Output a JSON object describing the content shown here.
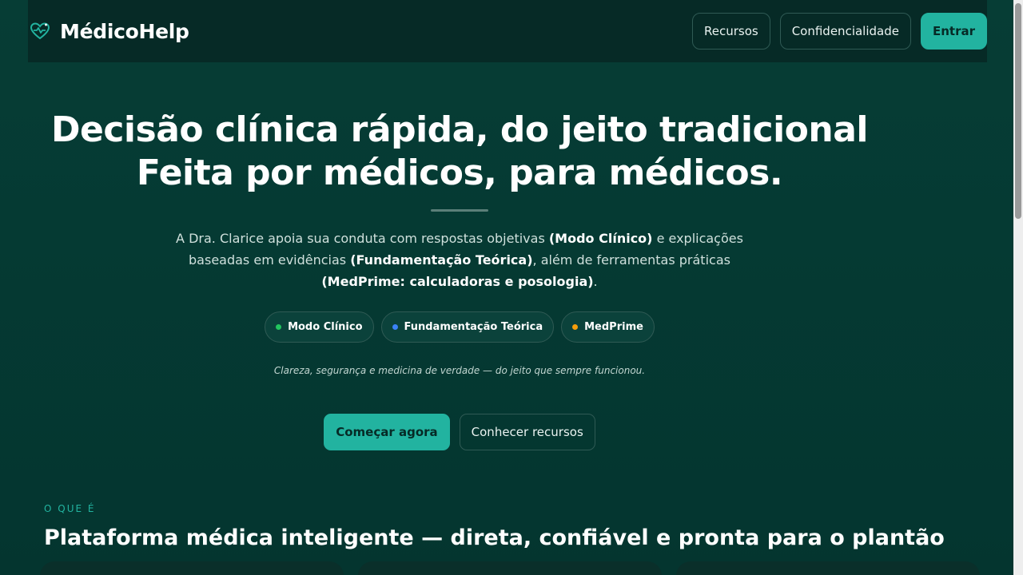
{
  "header": {
    "brand_name": "MédicoHelp",
    "brand_icon": "heart-pulse-icon",
    "nav": {
      "resources": "Recursos",
      "privacy": "Confidencialidade",
      "login": "Entrar"
    }
  },
  "hero": {
    "title_line1": "Decisão clínica rápida, do jeito tradicional",
    "title_line2": "Feita por médicos, para médicos.",
    "description": {
      "part1": "A Dra. Clarice apoia sua conduta com respostas objetivas ",
      "bold1": "(Modo Clínico)",
      "part2": " e explicações baseadas em evidências ",
      "bold2": "(Fundamentação Teórica)",
      "part3": ", além de ferramentas práticas ",
      "bold3": "(MedPrime: calculadoras e posologia)",
      "part4": "."
    },
    "chips": [
      {
        "label": "Modo Clínico",
        "color": "#22c55e"
      },
      {
        "label": "Fundamentação Teórica",
        "color": "#3b82f6"
      },
      {
        "label": "MedPrime",
        "color": "#f59e0b"
      }
    ],
    "tagline": "Clareza, segurança e medicina de verdade — do jeito que sempre funcionou.",
    "cta_primary": "Começar agora",
    "cta_secondary": "Conhecer recursos"
  },
  "section": {
    "eyebrow": "O QUE É",
    "title": "Plataforma médica inteligente — direta, confiável e pronta para o plantão"
  },
  "colors": {
    "background": "#053a33",
    "header": "#062a26",
    "accent": "#22b3a0"
  }
}
